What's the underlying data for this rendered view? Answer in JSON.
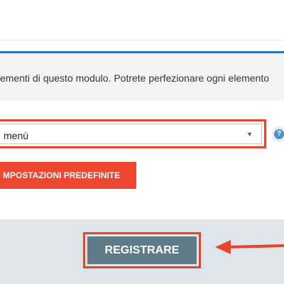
{
  "info": {
    "text": "ementi di questo modulo. Potrete perfezionare ogni elemento"
  },
  "select": {
    "value": "menù",
    "caret": "▼"
  },
  "help": {
    "icon_name": "help-icon",
    "glyph": "?"
  },
  "defaults_button": {
    "label": "MPOSTAZIONI PREDEFINITE"
  },
  "register_button": {
    "label": "REGISTRARE"
  },
  "annotation": {
    "highlight_color": "#e8432d",
    "arrow_icon": "arrow-left-icon"
  },
  "colors": {
    "accent_blue": "#2b73c6",
    "defaults_button_bg": "#ef4631",
    "register_button_bg": "#5f7b87",
    "footer_bg": "#dfe4e8"
  }
}
